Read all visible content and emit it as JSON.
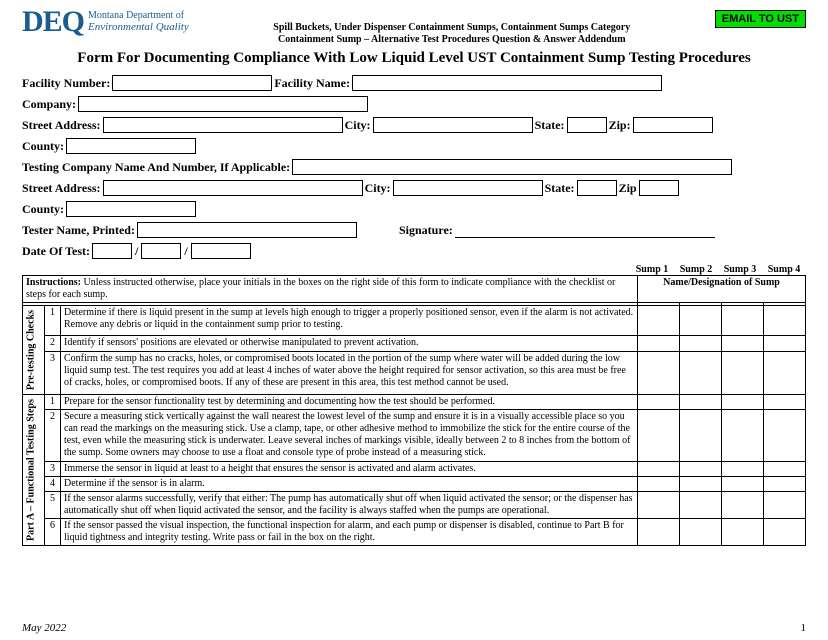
{
  "logo": {
    "acronym": "DEQ",
    "line1": "Montana Department of",
    "line2": "Environmental Quality"
  },
  "header": {
    "line1": "Spill Buckets, Under Dispenser Containment Sumps, Containment Sumps Category",
    "line2": "Containment Sump – Alternative Test Procedures Question & Answer Addendum"
  },
  "email_button": "EMAIL TO UST",
  "form_title": "Form For Documenting Compliance With Low Liquid Level UST Containment Sump Testing Procedures",
  "labels": {
    "facility_number": "Facility Number:",
    "facility_name": "Facility Name:",
    "company": "Company:",
    "street_address": "Street Address:",
    "city": "City:",
    "state": "State:",
    "zip": "Zip:",
    "zip2": "Zip",
    "county": "County:",
    "testing_company": "Testing Company Name And Number, If Applicable:",
    "tester_name": "Tester Name, Printed:",
    "signature": "Signature:",
    "date_of_test": "Date Of Test:"
  },
  "sump_cols": [
    "Sump 1",
    "Sump 2",
    "Sump 3",
    "Sump 4"
  ],
  "instructions": {
    "label": "Instructions:",
    "text": " Unless instructed otherwise, place your initials in the boxes on the right side of this form to indicate compliance with the checklist or steps for each sump.",
    "right": "Name/Designation of Sump"
  },
  "sections": {
    "pretest": {
      "title": "Pre-testing Checks",
      "rows": [
        {
          "n": "1",
          "t": "Determine if there is liquid present in the sump at levels high enough to trigger a properly positioned sensor, even if the alarm is not activated. Remove any debris or liquid in the containment sump prior to testing."
        },
        {
          "n": "2",
          "t": "Identify if sensors' positions are elevated or otherwise manipulated to prevent activation."
        },
        {
          "n": "3",
          "t": "Confirm the sump has no cracks, holes, or compromised boots located in the portion of the sump where water will be added during the low liquid sump test. The test requires you add at least 4 inches of water above the height required for sensor activation, so this area must be free of cracks, holes, or compromised boots. If any of these are present in this area, this test method cannot be used."
        }
      ]
    },
    "partA": {
      "title": "Part A – Functional Testing Steps",
      "rows": [
        {
          "n": "1",
          "t": "Prepare for the sensor functionality test by determining and documenting how the test should be performed."
        },
        {
          "n": "2",
          "t": "Secure a measuring stick vertically against the wall nearest the lowest level of the sump and ensure it is in a visually accessible place so you can read the markings on the measuring stick. Use a clamp, tape, or other adhesive method to immobilize the stick for the entire course of the test, even while the measuring stick is underwater. Leave several inches of markings visible, ideally between 2 to 8 inches from the bottom of the sump. Some owners may choose to use a float and console type of probe instead of a measuring stick."
        },
        {
          "n": "3",
          "t": "Immerse the sensor in liquid at least to a height that ensures the sensor is activated and alarm activates."
        },
        {
          "n": "4",
          "t": "Determine if the sensor is in alarm."
        },
        {
          "n": "5",
          "t": "If the sensor alarms successfully, verify that either: The pump has automatically shut off when liquid activated the sensor; or the dispenser has automatically shut off when liquid activated the sensor, and the facility is always staffed when the pumps are operational."
        },
        {
          "n": "6",
          "t": "If the sensor passed the visual inspection, the functional inspection for alarm, and each pump or dispenser is disabled, continue to Part B for liquid tightness and integrity testing. Write pass or fail in the box on the right."
        }
      ]
    }
  },
  "footer": {
    "date": "May 2022",
    "page": "1"
  }
}
